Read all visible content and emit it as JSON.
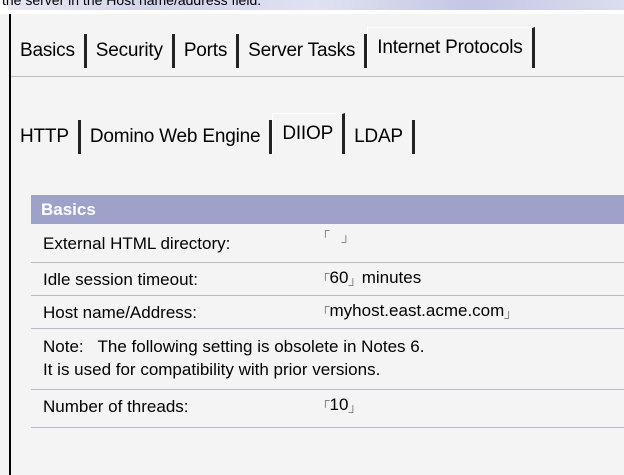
{
  "caption": "the server in the Host name/address field.",
  "main_tabs": [
    {
      "label": "Basics",
      "active": false
    },
    {
      "label": "Security",
      "active": false
    },
    {
      "label": "Ports",
      "active": false
    },
    {
      "label": "Server Tasks",
      "active": false
    },
    {
      "label": "Internet Protocols",
      "active": true
    }
  ],
  "sub_tabs": [
    {
      "label": "HTTP",
      "active": false
    },
    {
      "label": "Domino Web Engine",
      "active": false
    },
    {
      "label": "DIIOP",
      "active": true
    },
    {
      "label": "LDAP",
      "active": false
    }
  ],
  "section": {
    "title": "Basics",
    "fields": {
      "external_html": {
        "label": "External HTML directory:",
        "value": ""
      },
      "idle_timeout": {
        "label": "Idle session timeout:",
        "value": "60",
        "unit": "minutes"
      },
      "host_name": {
        "label": "Host name/Address:",
        "value": "myhost.east.acme.com"
      },
      "note": {
        "line1": "Note:   The following setting is obsolete in Notes 6.",
        "line2": "It is used for compatibility with prior versions."
      },
      "threads": {
        "label": "Number of threads:",
        "value": "10"
      }
    }
  },
  "glyphs": {
    "bracket_open": "┌",
    "bracket_close": "┘"
  }
}
